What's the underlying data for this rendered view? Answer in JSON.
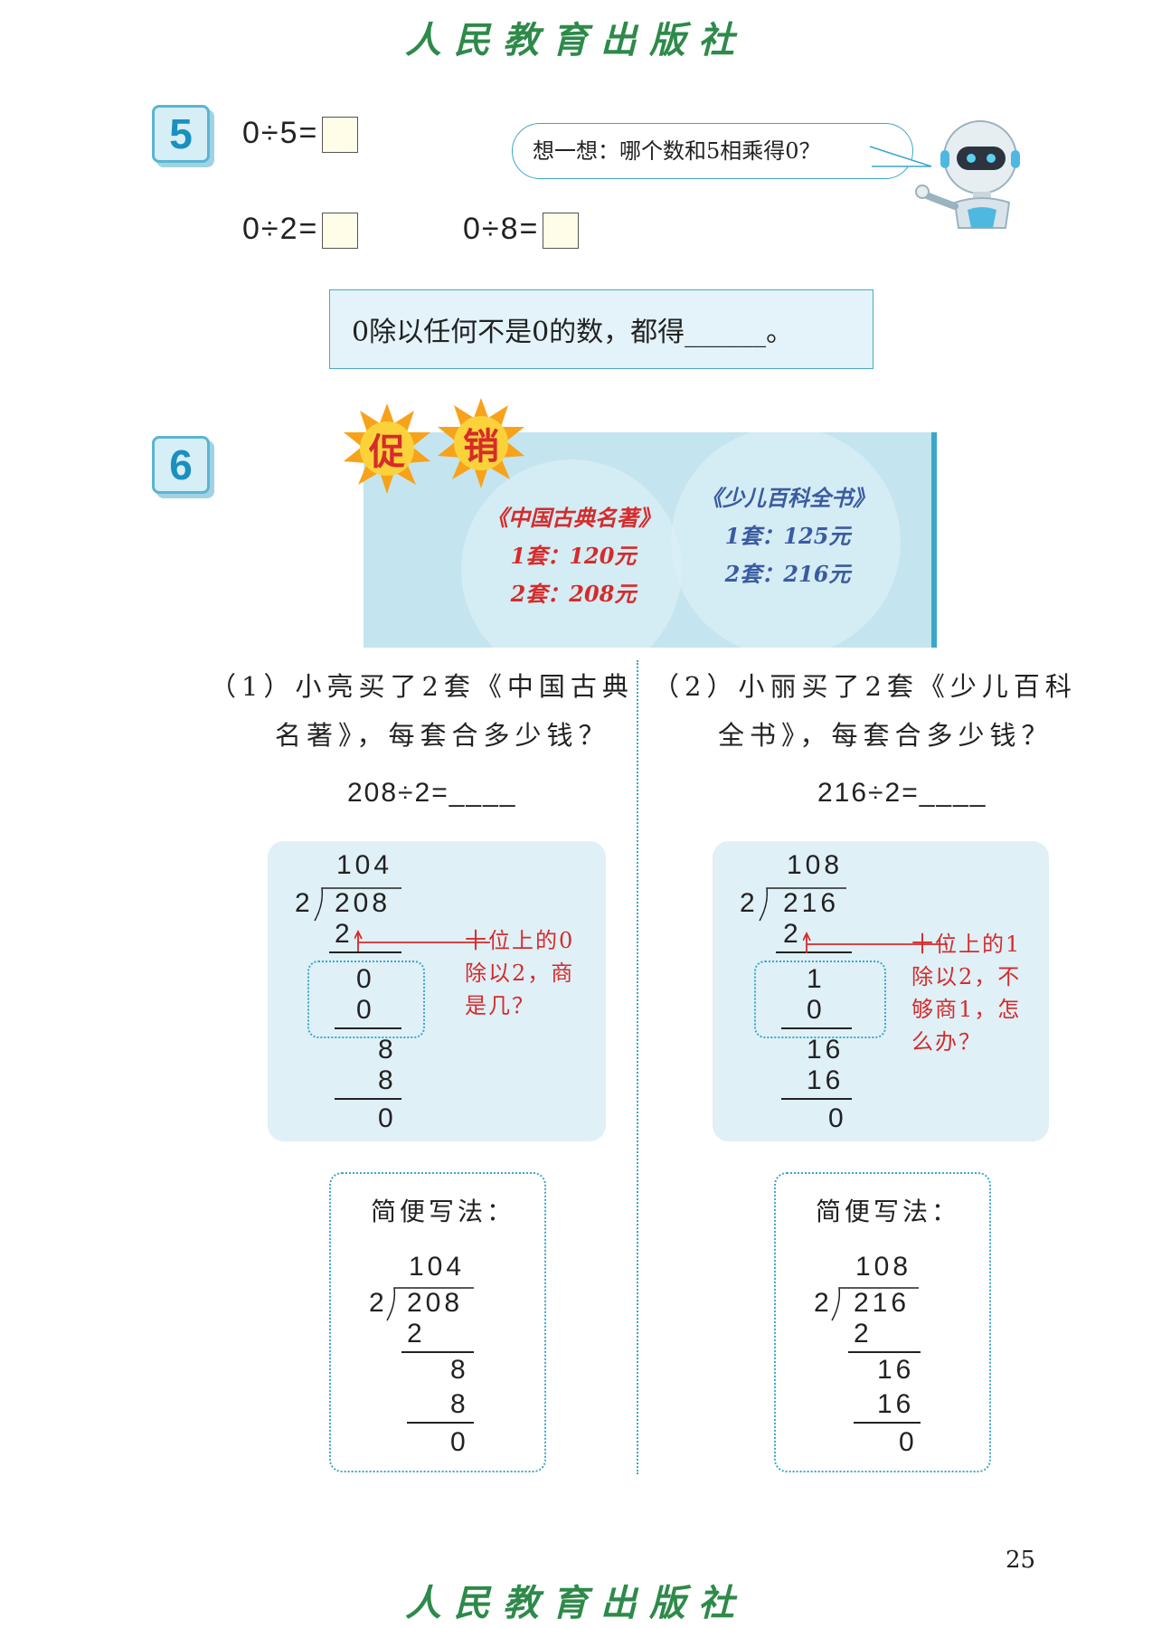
{
  "watermark": "人民教育出版社",
  "page_number": "25",
  "problem5": {
    "number": "5",
    "eq1": "0÷5=",
    "eq2": "0÷2=",
    "eq3": "0÷8=",
    "bubble": "想一想：哪个数和5相乘得0？",
    "rule": "0除以任何不是0的数，都得______。"
  },
  "problem6": {
    "number": "6",
    "burst1": "促",
    "burst2": "销",
    "book1": {
      "title": "《中国古典名著》",
      "price1": "1套：120元",
      "price2": "2套：208元"
    },
    "book2": {
      "title": "《少儿百科全书》",
      "price1": "1套：125元",
      "price2": "2套：216元"
    },
    "q1_line1": "（1）小亮买了2套《中国古典",
    "q1_line2": "名著》，每套合多少钱？",
    "q2_line1": "（2）小丽买了2套《少儿百科",
    "q2_line2": "全书》，每套合多少钱？",
    "eq_left": "208÷2=____",
    "eq_right": "216÷2=____",
    "left_calc": {
      "quotient": "104",
      "divisor": "2",
      "dividend": "208",
      "r1": "2",
      "r2": "0",
      "r3": "0",
      "r4": "8",
      "r5": "8",
      "r6": "0",
      "note": [
        "十位上的0",
        "除以2，商",
        "是几？"
      ]
    },
    "right_calc": {
      "quotient": "108",
      "divisor": "2",
      "dividend": "216",
      "r1": "2",
      "r2": "1",
      "r3": "0",
      "r4": "16",
      "r5": "16",
      "r6": "0",
      "note": [
        "十位上的1",
        "除以2，不",
        "够商1，怎",
        "么办？"
      ]
    },
    "simple_title": "简便写法：",
    "left_simple": {
      "quotient": "104",
      "divisor": "2",
      "dividend": "208",
      "r1": "2",
      "r2": "8",
      "r3": "8",
      "r4": "0"
    },
    "right_simple": {
      "quotient": "108",
      "divisor": "2",
      "dividend": "216",
      "r1": "2",
      "r2": "16",
      "r3": "16",
      "r4": "0"
    }
  }
}
